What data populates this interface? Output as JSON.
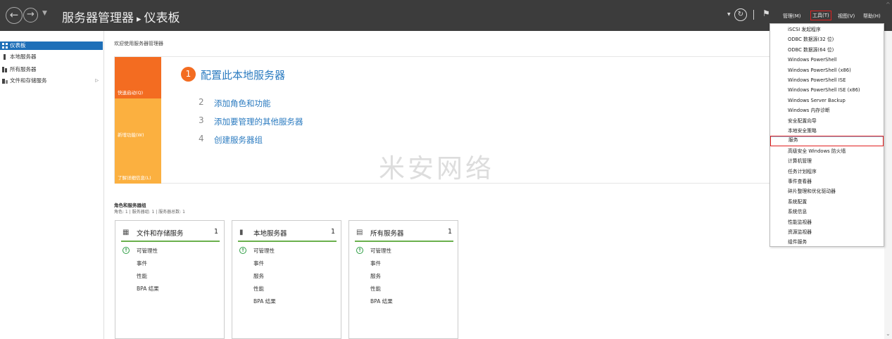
{
  "titlebar": {
    "app": "服务器管理器",
    "page": "仪表板",
    "menu": {
      "manage": "管理(M)",
      "tools": "工具(T)",
      "view": "视图(V)",
      "help": "帮助(H)"
    }
  },
  "sidebar": {
    "items": [
      {
        "label": "仪表板",
        "icon": "dashboard-icon"
      },
      {
        "label": "本地服务器",
        "icon": "server-icon"
      },
      {
        "label": "所有服务器",
        "icon": "servers-icon"
      },
      {
        "label": "文件和存储服务",
        "icon": "storage-icon"
      }
    ]
  },
  "main": {
    "welcome": "欢迎使用服务器管理器",
    "tiles": [
      "快速启动(Q)",
      "新增功能(W)",
      "了解详细信息(L)"
    ],
    "steps": [
      {
        "num": "1",
        "label": "配置此本地服务器"
      },
      {
        "num": "2",
        "label": "添加角色和功能"
      },
      {
        "num": "3",
        "label": "添加要管理的其他服务器"
      },
      {
        "num": "4",
        "label": "创建服务器组"
      }
    ],
    "watermark": "米安网络",
    "roles_title": "角色和服务器组",
    "roles_subtitle": "角色: 1 | 服务器组: 1 | 服务器总数: 1",
    "cards": [
      {
        "title": "文件和存储服务",
        "count": "1",
        "rows": [
          "可管理性",
          "事件",
          "性能",
          "BPA 结果"
        ]
      },
      {
        "title": "本地服务器",
        "count": "1",
        "rows": [
          "可管理性",
          "事件",
          "服务",
          "性能",
          "BPA 结果"
        ]
      },
      {
        "title": "所有服务器",
        "count": "1",
        "rows": [
          "可管理性",
          "事件",
          "服务",
          "性能",
          "BPA 结果"
        ]
      }
    ]
  },
  "tools_menu": {
    "items": [
      "iSCSI 发起程序",
      "ODBC 数据源(32 位)",
      "ODBC 数据源(64 位)",
      "Windows PowerShell",
      "Windows PowerShell (x86)",
      "Windows PowerShell ISE",
      "Windows PowerShell ISE (x86)",
      "Windows Server Backup",
      "Windows 内存诊断",
      "安全配置向导",
      "本地安全策略",
      "服务",
      "高级安全 Windows 防火墙",
      "计算机管理",
      "任务计划程序",
      "事件查看器",
      "碎片整理和优化驱动器",
      "系统配置",
      "系统信息",
      "性能监视器",
      "资源监视器",
      "组件服务"
    ],
    "highlighted": "服务"
  },
  "colors": {
    "titlebar": "#3c3c3c",
    "accent_orange": "#f36c21",
    "tile_light_orange": "#fbb040",
    "link_blue": "#2b7bc0",
    "active_blue": "#1e6fb8",
    "ok_green": "#2e9e44",
    "highlight_red": "#e02020"
  }
}
